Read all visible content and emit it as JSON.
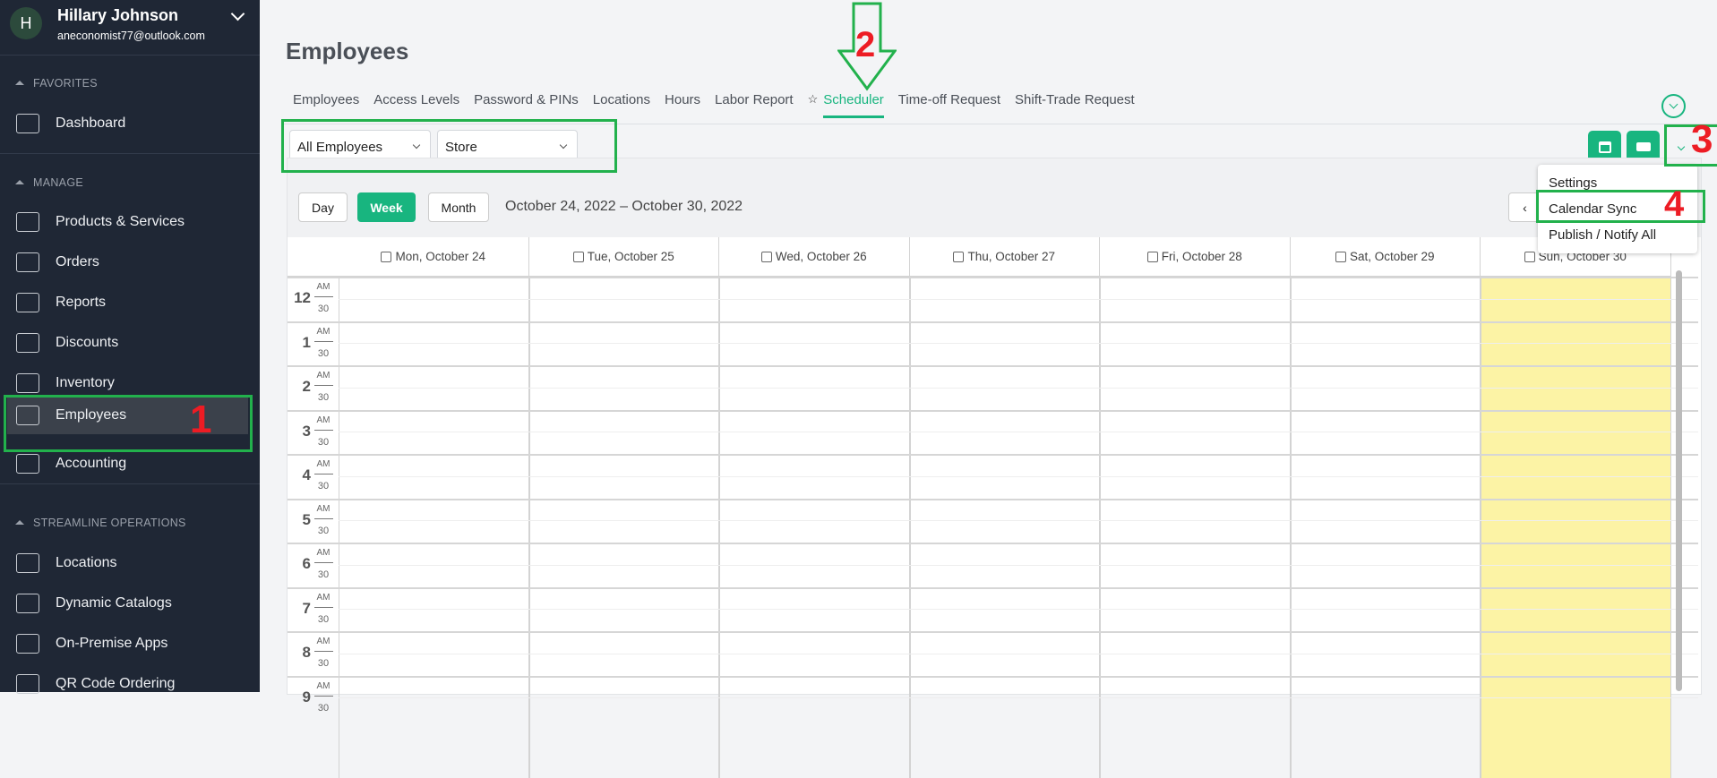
{
  "user": {
    "initial": "H",
    "name": "Hillary Johnson",
    "email": "aneconomist77@outlook.com"
  },
  "sidebar": {
    "sections": [
      "FAVORITES",
      "MANAGE",
      "STREAMLINE OPERATIONS"
    ],
    "items": [
      {
        "label": "Dashboard",
        "icon": "monitor-icon"
      },
      {
        "label": "Products & Services",
        "icon": "products-icon"
      },
      {
        "label": "Orders",
        "icon": "orders-icon"
      },
      {
        "label": "Reports",
        "icon": "reports-icon"
      },
      {
        "label": "Discounts",
        "icon": "percent-icon"
      },
      {
        "label": "Inventory",
        "icon": "inventory-icon"
      },
      {
        "label": "Employees",
        "icon": "employees-icon",
        "active": true
      },
      {
        "label": "Accounting",
        "icon": "calculator-icon"
      },
      {
        "label": "Locations",
        "icon": "location-pin-icon"
      },
      {
        "label": "Dynamic Catalogs",
        "icon": "catalog-icon"
      },
      {
        "label": "On-Premise Apps",
        "icon": "pos-terminal-icon"
      },
      {
        "label": "QR Code Ordering",
        "icon": "qr-code-icon"
      }
    ]
  },
  "page": {
    "title": "Employees"
  },
  "tabs": [
    "Employees",
    "Access Levels",
    "Password & PINs",
    "Locations",
    "Hours",
    "Labor Report",
    "Scheduler",
    "Time-off Request",
    "Shift-Trade Request"
  ],
  "active_tab": "Scheduler",
  "filters": {
    "employees": "All Employees",
    "location": "Store"
  },
  "calendar": {
    "views": [
      "Day",
      "Week",
      "Month"
    ],
    "active_view": "Week",
    "range": "October 24, 2022 – October 30, 2022",
    "days": [
      "Mon, October 24",
      "Tue, October 25",
      "Wed, October 26",
      "Thu, October 27",
      "Fri, October 28",
      "Sat, October 29",
      "Sun, October 30"
    ],
    "today_index": 6,
    "hours": [
      "12",
      "1",
      "2",
      "3",
      "4",
      "5",
      "6",
      "7",
      "8",
      "9"
    ],
    "ampm": "AM",
    "half": "30",
    "prev": "‹"
  },
  "menu": {
    "items": [
      "Settings",
      "Calendar Sync",
      "Publish / Notify All"
    ]
  },
  "annotations": [
    "1",
    "2",
    "3",
    "4"
  ],
  "colors": {
    "accent": "#18b57f",
    "sidebar": "#1f2735",
    "today": "#fcf3a5",
    "annotation_box": "#22b14c",
    "annotation_number": "#ed1c24"
  }
}
